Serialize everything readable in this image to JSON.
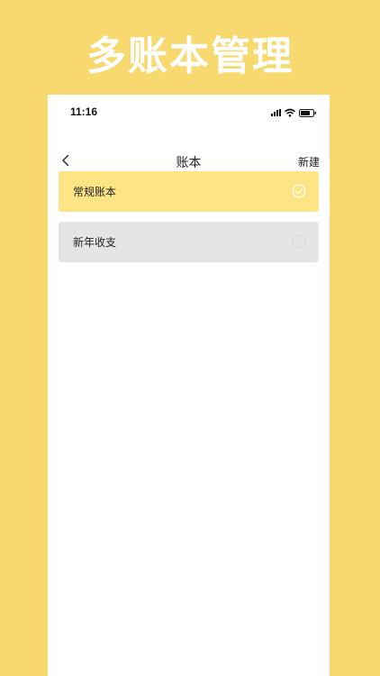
{
  "promo": {
    "title": "多账本管理"
  },
  "status_bar": {
    "time": "11:16"
  },
  "nav": {
    "title": "账本",
    "new_label": "新建"
  },
  "books": [
    {
      "label": "常规账本",
      "selected": true
    },
    {
      "label": "新年收支",
      "selected": false
    }
  ],
  "colors": {
    "background": "#F8D96F",
    "selected_item": "#FDE485",
    "unselected_item": "#E5E5E5"
  },
  "icons": [
    "signal-icon",
    "wifi-icon",
    "battery-icon",
    "back-chevron-icon",
    "check-circle-icon",
    "empty-circle-icon"
  ]
}
